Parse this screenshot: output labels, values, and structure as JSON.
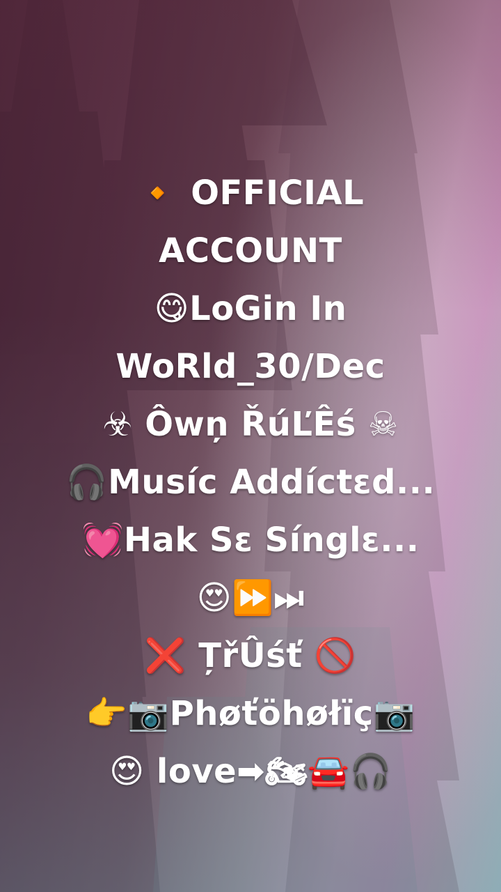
{
  "caption": {
    "lines": [
      "🔸 OFFICIAL",
      "ACCOUNT",
      "😋LoGin In",
      "WoRld_30/Dec",
      "☣ Ôwņ ŘúĽÊś ☠",
      "🎧Musíc Addíctɛd...",
      "💓Hak Sɛ Sínglɛ...",
      "😍⏩⏭",
      "❌ ȚřÛśť 🚫",
      "👉📷Phøťöhøłïç📷",
      "😍 love➡🏍🚘🎧"
    ]
  }
}
